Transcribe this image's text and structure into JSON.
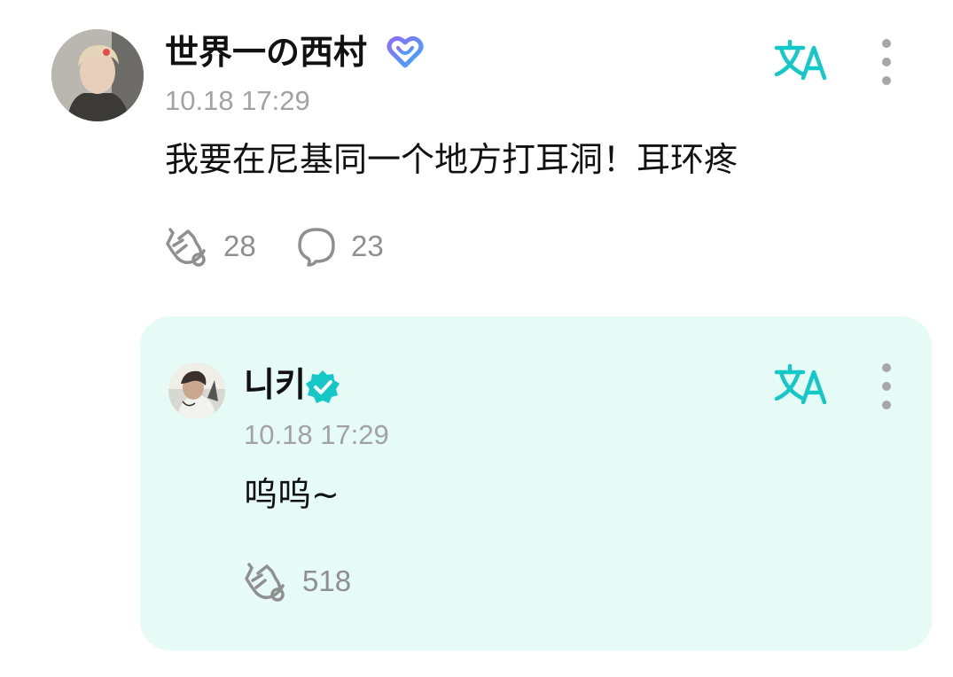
{
  "post": {
    "author": {
      "name": "世界一の西村",
      "badge_icon": "heart-badge-icon",
      "avatar_icon": "profile-photo"
    },
    "timestamp": "10.18 17:29",
    "text": "我要在尼基同一个地方打耳洞！耳环疼",
    "likes": "28",
    "comments": "23",
    "actions": {
      "translate_icon": "translate-icon",
      "more_icon": "more-vertical-icon",
      "like_icon": "clap-icon",
      "comment_icon": "comment-bubble-icon"
    }
  },
  "reply": {
    "author": {
      "name": "니키",
      "badge_icon": "verified-badge-icon",
      "avatar_icon": "profile-photo"
    },
    "timestamp": "10.18 17:29",
    "text": "呜呜~",
    "likes": "518",
    "background": "#e6fbf6",
    "actions": {
      "translate_icon": "translate-icon",
      "more_icon": "more-vertical-icon",
      "like_icon": "clap-icon"
    }
  },
  "colors": {
    "accent": "#14c8c8",
    "badge_purple": "#7b6cf6",
    "badge_blue": "#3fa6ff",
    "muted_text": "#a2a2a2",
    "count_text": "#8f8f8f"
  }
}
